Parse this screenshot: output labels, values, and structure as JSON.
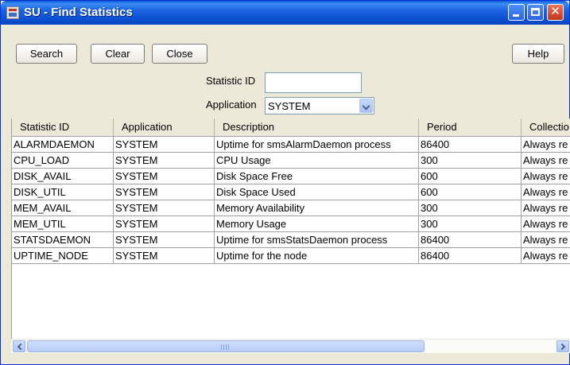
{
  "window": {
    "title": "SU - Find Statistics",
    "controls": [
      "minimize",
      "maximize",
      "close"
    ]
  },
  "toolbar": {
    "search_label": "Search",
    "clear_label": "Clear",
    "close_label": "Close",
    "help_label": "Help"
  },
  "form": {
    "statistic_id_label": "Statistic ID",
    "statistic_id_value": "",
    "application_label": "Application",
    "application_value": "SYSTEM"
  },
  "table": {
    "columns": [
      "Statistic ID",
      "Application",
      "Description",
      "Period",
      "Collectio"
    ],
    "rows": [
      [
        "ALARMDAEMON",
        "SYSTEM",
        "Uptime for smsAlarmDaemon process",
        "86400",
        "Always re"
      ],
      [
        "CPU_LOAD",
        "SYSTEM",
        "CPU Usage",
        "300",
        "Always re"
      ],
      [
        "DISK_AVAIL",
        "SYSTEM",
        "Disk Space Free",
        "600",
        "Always re"
      ],
      [
        "DISK_UTIL",
        "SYSTEM",
        "Disk Space Used",
        "600",
        "Always re"
      ],
      [
        "MEM_AVAIL",
        "SYSTEM",
        "Memory Availability",
        "300",
        "Always re"
      ],
      [
        "MEM_UTIL",
        "SYSTEM",
        "Memory Usage",
        "300",
        "Always re"
      ],
      [
        "STATSDAEMON",
        "SYSTEM",
        "Uptime for smsStatsDaemon process",
        "86400",
        "Always re"
      ],
      [
        "UPTIME_NODE",
        "SYSTEM",
        "Uptime for the node",
        "86400",
        "Always re"
      ]
    ]
  },
  "colors": {
    "titlebar": "#0a4fd0",
    "window_bg": "#ece9d8",
    "close_button": "#c2351a"
  },
  "icons": [
    "app-icon",
    "minimize-icon",
    "maximize-icon",
    "close-icon",
    "dropdown-arrow-icon",
    "scroll-left-icon",
    "scroll-right-icon"
  ]
}
